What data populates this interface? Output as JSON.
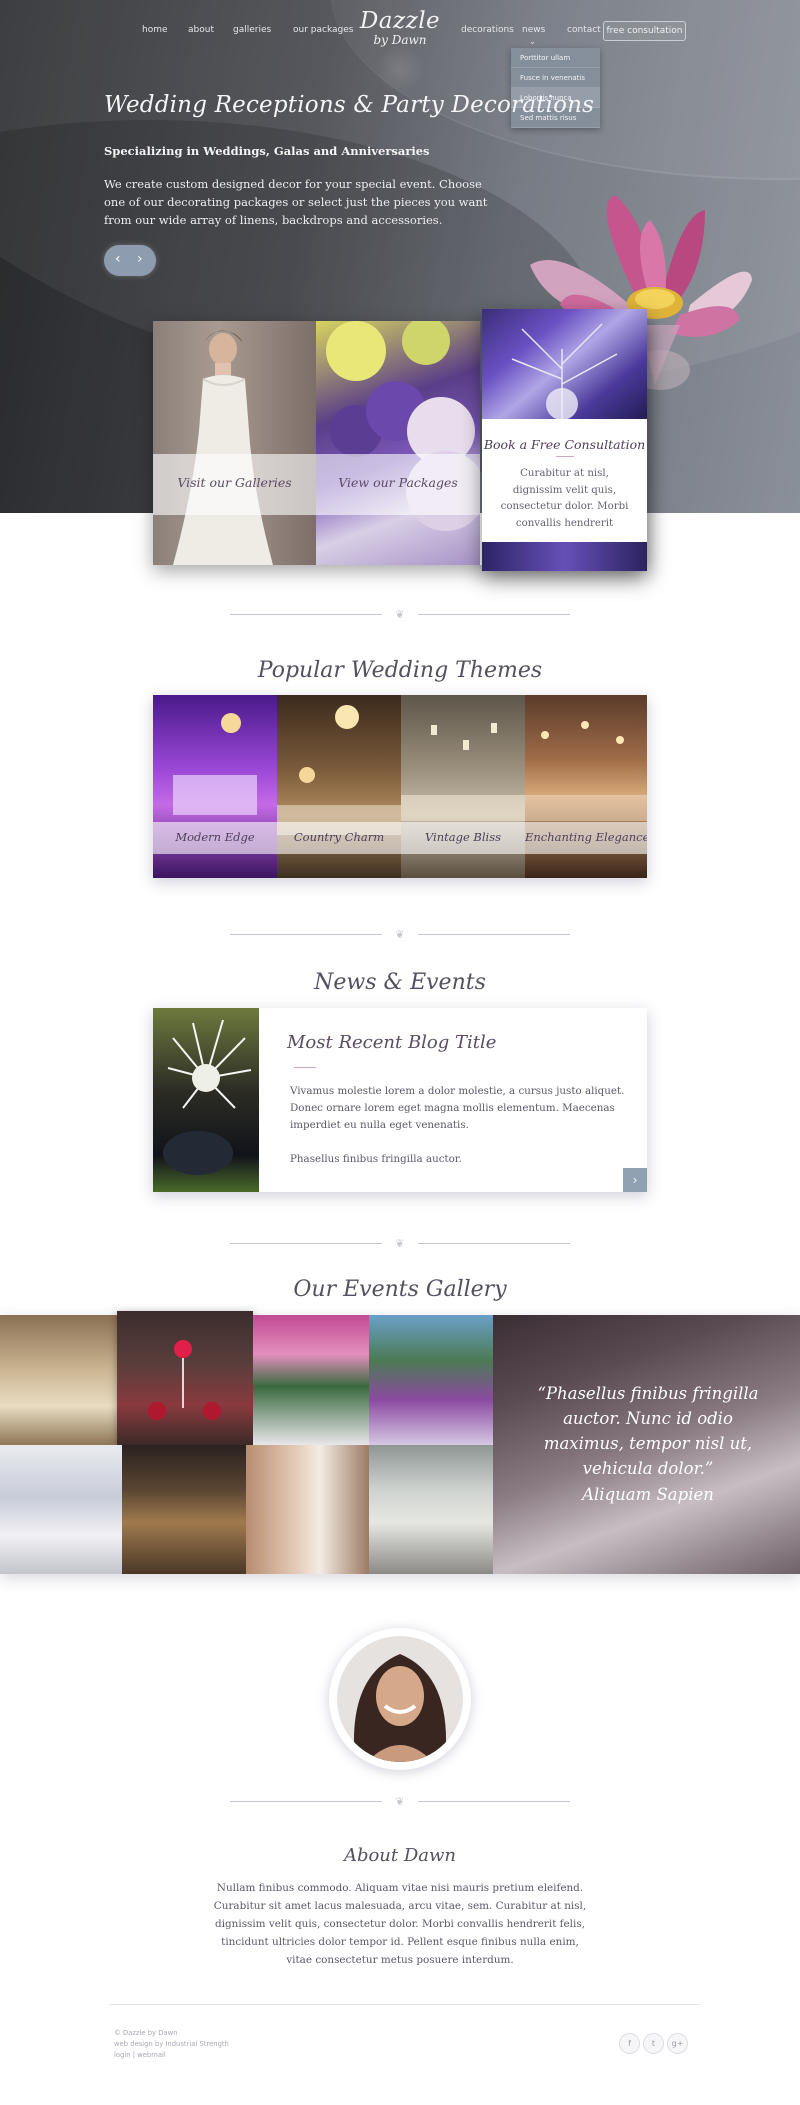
{
  "nav": {
    "home": "home",
    "about": "about",
    "galleries": "galleries",
    "packages": "our packages",
    "decorations": "decorations",
    "news": "news",
    "contact": "contact",
    "consultation": "free consultation",
    "news_menu": [
      "Porttitor ullam",
      "Fusce in venenatis",
      "Lobortis nunca",
      "Sed mattis risus"
    ],
    "news_menu_active_index": 2
  },
  "logo": {
    "line1": "Dazzle",
    "line2": "by Dawn"
  },
  "hero": {
    "title": "Wedding Receptions & Party Decorations",
    "subtitle": "Specializing in Weddings, Galas and Anniversaries",
    "description": "We create custom designed decor for your special event. Choose one of our decorating packages or select just the pieces you want from our wide array of linens, backdrops and accessories.",
    "prev_icon": "‹",
    "next_icon": "›"
  },
  "features": {
    "galleries": "Visit our Galleries",
    "packages": "View our Packages",
    "book_title": "Book a Free Consultation",
    "book_text": "Curabitur at nisl, dignissim velit quis, consectetur dolor. Morbi convallis hendrerit"
  },
  "themes": {
    "title": "Popular Wedding Themes",
    "items": [
      "Modern Edge",
      "Country Charm",
      "Vintage Bliss",
      "Enchanting Elegance"
    ]
  },
  "news": {
    "title": "News & Events",
    "post_title": "Most Recent Blog Title",
    "post_text": "Vivamus molestie lorem a dolor molestie, a cursus justo aliquet. Donec ornare lorem eget magna mollis elementum. Maecenas imperdiet eu nulla eget venenatis.",
    "post_text2": "Phasellus finibus fringilla auctor.",
    "next_icon": "›"
  },
  "gallery": {
    "title": "Our Events Gallery",
    "quote": "“Phasellus finibus fringilla auctor. Nunc id odio maximus, tempor nisl ut, vehicula dolor.”",
    "author": "Aliquam Sapien"
  },
  "about": {
    "title": "About Dawn",
    "text": "Nullam finibus commodo. Aliquam vitae nisi mauris pretium eleifend. Curabitur sit amet lacus malesuada, arcu vitae, sem. Curabitur at nisl, dignissim velit quis, consectetur dolor. Morbi convallis hendrerit felis, tincidunt ultricies dolor tempor id. Pellent esque finibus nulla enim, vitae consectetur metus posuere interdum."
  },
  "footer": {
    "copyright": "© Dazzle by Dawn",
    "credit": "web design by Industrial Strength",
    "login": "login | webmail",
    "social": [
      "f",
      "t",
      "g+"
    ]
  },
  "icons": [
    "prev-arrow-icon",
    "next-arrow-icon",
    "chevron-down-icon",
    "divider-ornament-icon",
    "facebook-icon",
    "twitter-icon",
    "google-plus-icon"
  ],
  "colors": {
    "hero_dark": "#2f3033",
    "hero_light": "#8a9099",
    "accent_blue": "#8fa1b3",
    "title_purple": "#55505f"
  }
}
